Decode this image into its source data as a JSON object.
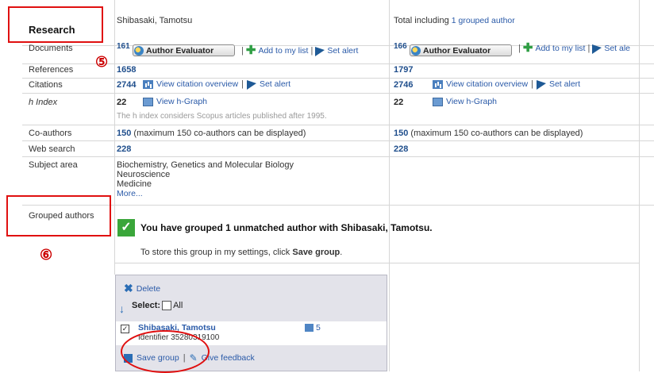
{
  "header": {
    "section_title": "Research",
    "author_name": "Shibasaki, Tamotsu",
    "total_prefix": "Total including ",
    "total_link": "1 grouped author"
  },
  "rows": {
    "documents": "Documents",
    "references": "References",
    "citations": "Citations",
    "h_index": "h Index",
    "coauthors": "Co-authors",
    "web_search": "Web search",
    "subject_area": "Subject area",
    "grouped_authors": "Grouped authors"
  },
  "col1": {
    "documents": "161",
    "references": "1658",
    "citations": "2744",
    "h_index": "22",
    "h_note": "The h index considers Scopus articles published after 1995.",
    "coauthors": "150",
    "coauthors_note": "(maximum 150 co-authors can be displayed)",
    "web_search": "228",
    "subjects": [
      "Biochemistry, Genetics and Molecular Biology",
      "Neuroscience",
      "Medicine"
    ],
    "more": "More..."
  },
  "col2": {
    "documents": "166",
    "references": "1797",
    "citations": "2746",
    "h_index": "22",
    "coauthors": "150",
    "coauthors_note": "(maximum 150 co-authors can be displayed)",
    "web_search": "228"
  },
  "actions": {
    "author_evaluator": "Author Evaluator",
    "add_to_list": "Add to my list",
    "set_alert": "Set alert",
    "set_alert_cut": "Set ale",
    "view_citation": "View citation overview",
    "view_hgraph": "View h-Graph",
    "separator": "|"
  },
  "grouped": {
    "message": "You have grouped 1 unmatched author with Shibasaki, Tamotsu.",
    "store_prefix": "To store this group in my settings, click ",
    "store_bold": "Save group",
    "store_suffix": "."
  },
  "panel": {
    "delete": "Delete",
    "select_label": "Select:",
    "all_label": "All",
    "author_name": "Shibasaki, Tamotsu",
    "identifier": "Identifier 35280319100",
    "doc_count": "5",
    "save_group": "Save group",
    "give_feedback": "Give feedback"
  },
  "annotations": {
    "step5": "⑤",
    "step6": "⑥"
  },
  "colors": {
    "annotation_red": "#e01010",
    "link_blue": "#2a5aa8",
    "number_blue": "#1f4e8c"
  }
}
